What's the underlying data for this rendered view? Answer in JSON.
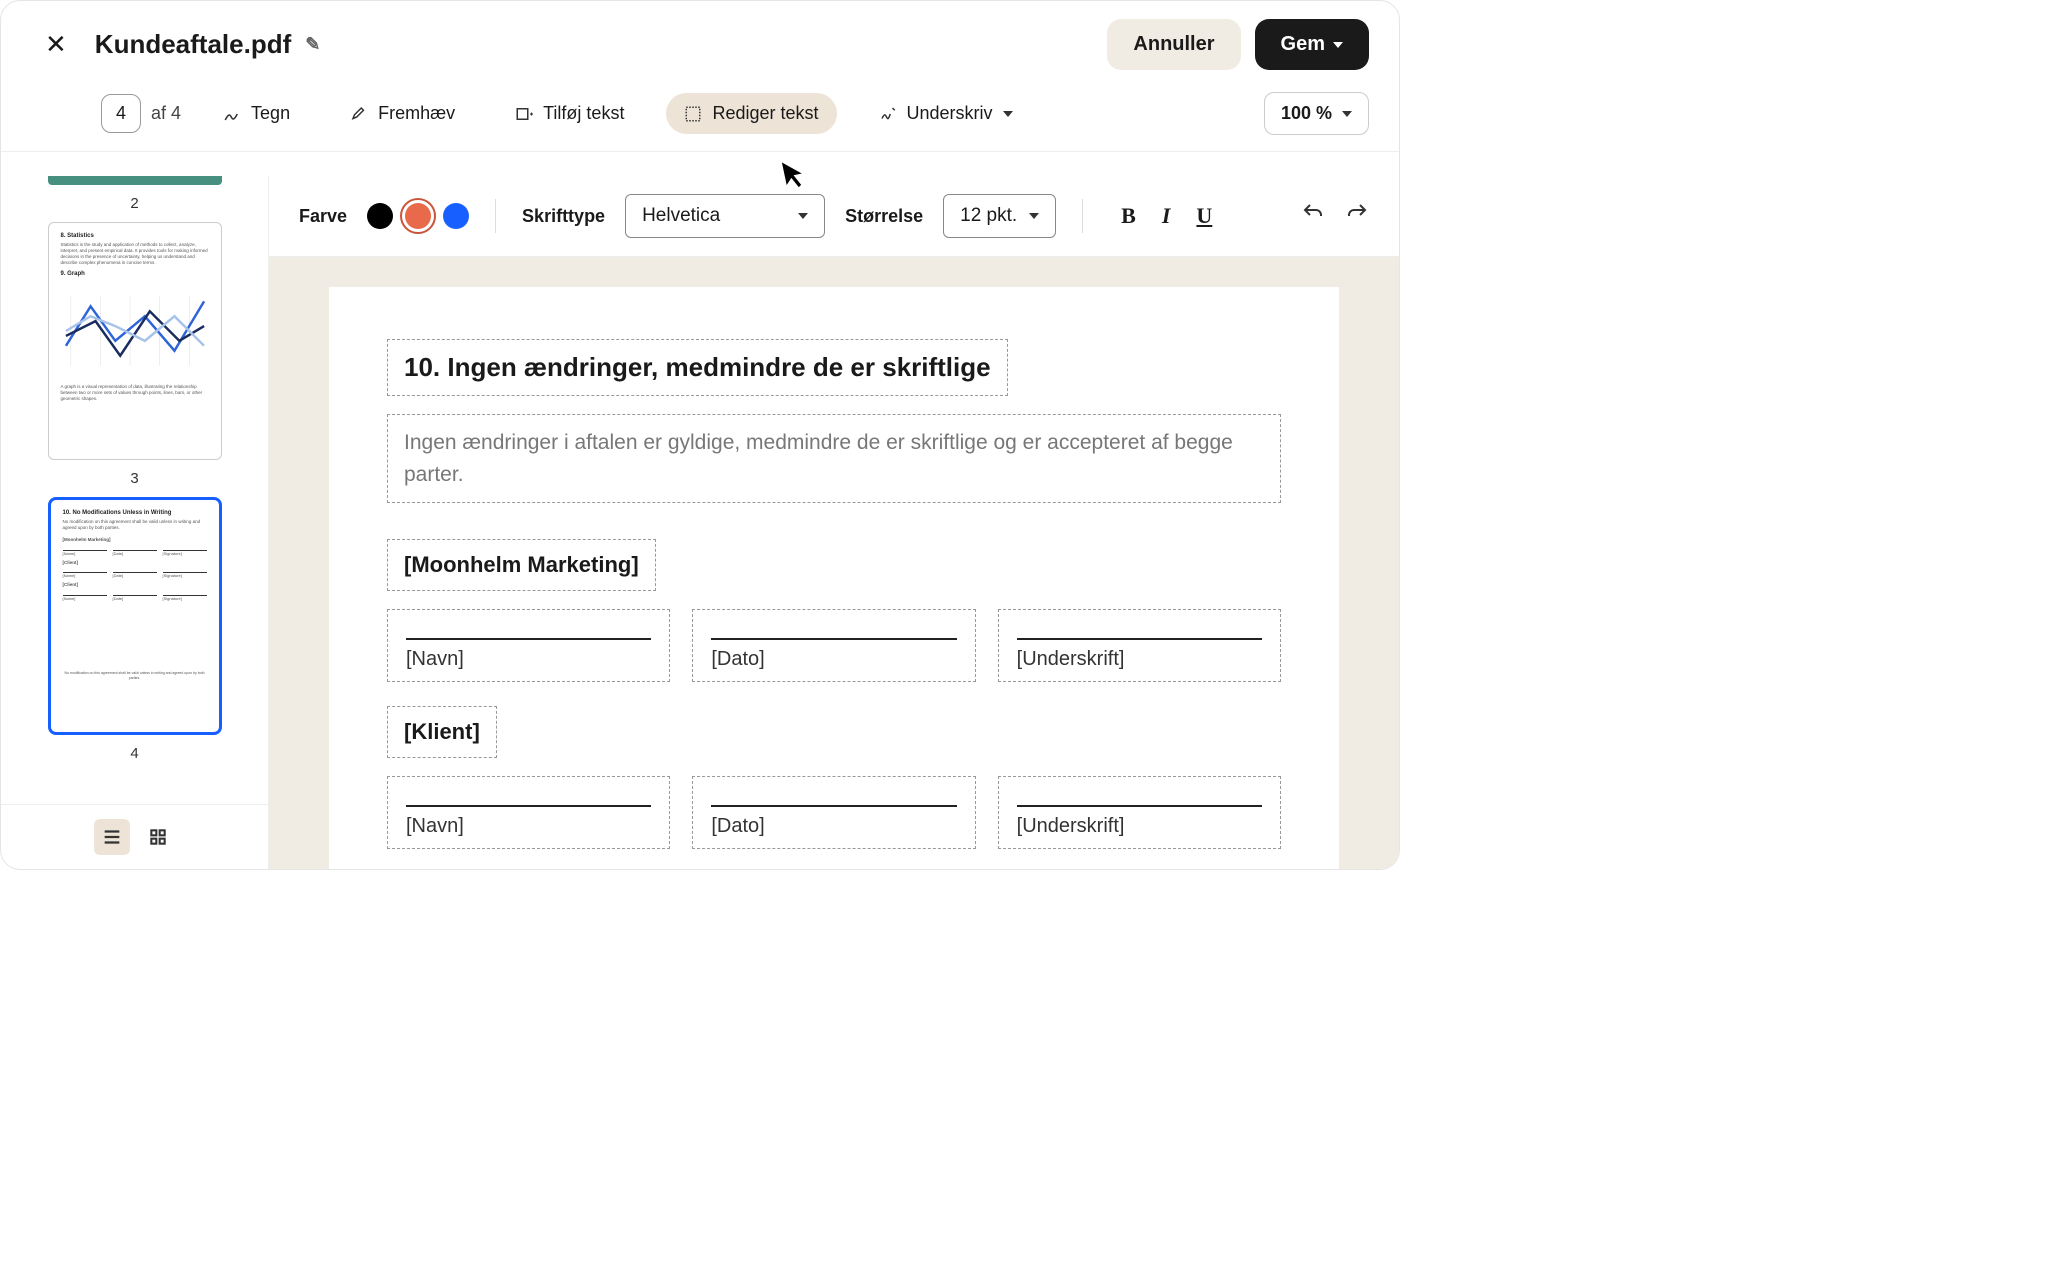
{
  "header": {
    "filename": "Kundeaftale.pdf",
    "cancel": "Annuller",
    "save": "Gem"
  },
  "toolbar": {
    "page_current": "4",
    "page_total": "af 4",
    "draw": "Tegn",
    "highlight": "Fremhæv",
    "add_text": "Tilføj tekst",
    "edit_text": "Rediger tekst",
    "sign": "Underskriv",
    "zoom": "100 %"
  },
  "format": {
    "color_label": "Farve",
    "font_label": "Skrifttype",
    "font_value": "Helvetica",
    "size_label": "Størrelse",
    "size_value": "12 pkt."
  },
  "thumbs": {
    "p2": "2",
    "p3": "3",
    "p4": "4",
    "t3_h1": "8. Statistics",
    "t3_p1": "Statistics is the study and application of methods to collect, analyze, interpret, and present empirical data. It provides tools for making informed decisions in the presence of uncertainty, helping us understand and describe complex phenomena in concise terms.",
    "t3_h2": "9. Graph",
    "t3_p2": "A graph is a visual representation of data, illustrating the relationship between two or more sets of values through points, lines, bars, or other geometric shapes.",
    "t4_h": "10. No Modifications Unless in Writing",
    "t4_p": "No modification on this agreement shall be valid unless in writing and agreed upon by both parties.",
    "t4_mm": "[Moonhelm Marketing]",
    "t4_client": "[Client]",
    "t4_name": "[Name]",
    "t4_date": "[Date]",
    "t4_sig": "[Signature]",
    "t4_foot": "No modification on this agreement shall be valid unless in writing and agreed upon by both parties."
  },
  "doc": {
    "title": "10. Ingen ændringer, medmindre de er skriftlige",
    "para": "Ingen ændringer i aftalen er gyldige, medmindre de er skriftlige og er accepteret af begge parter.",
    "party1": "[Moonhelm Marketing]",
    "party2": "[Klient]",
    "name": "[Navn]",
    "date": "[Dato]",
    "signature": "[Underskrift]"
  }
}
